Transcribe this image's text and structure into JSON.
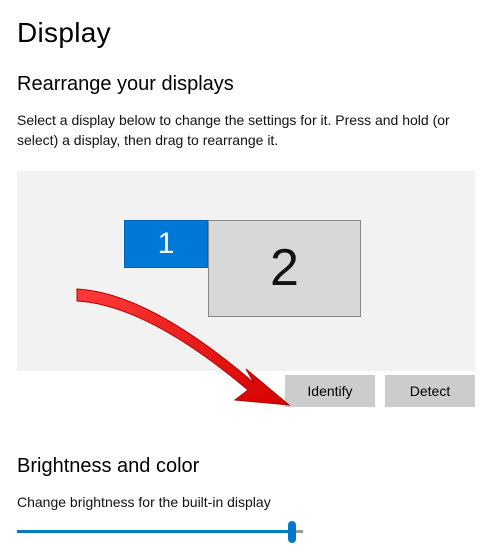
{
  "title": "Display",
  "rearrange": {
    "heading": "Rearrange your displays",
    "subtext": "Select a display below to change the settings for it. Press and hold (or select) a display, then drag to rearrange it.",
    "displays": {
      "d1": "1",
      "d2": "2"
    },
    "buttons": {
      "identify": "Identify",
      "detect": "Detect"
    }
  },
  "brightness": {
    "heading": "Brightness and color",
    "slider_label": "Change brightness for the built-in display",
    "slider_value": 96
  },
  "colors": {
    "accent": "#0078d7",
    "slider_fill": "#0079cb",
    "panel_bg": "#f2f2f2",
    "button_bg": "#cccccc",
    "display2_bg": "#d8d8d8",
    "annotation_red": "#ff0000"
  }
}
